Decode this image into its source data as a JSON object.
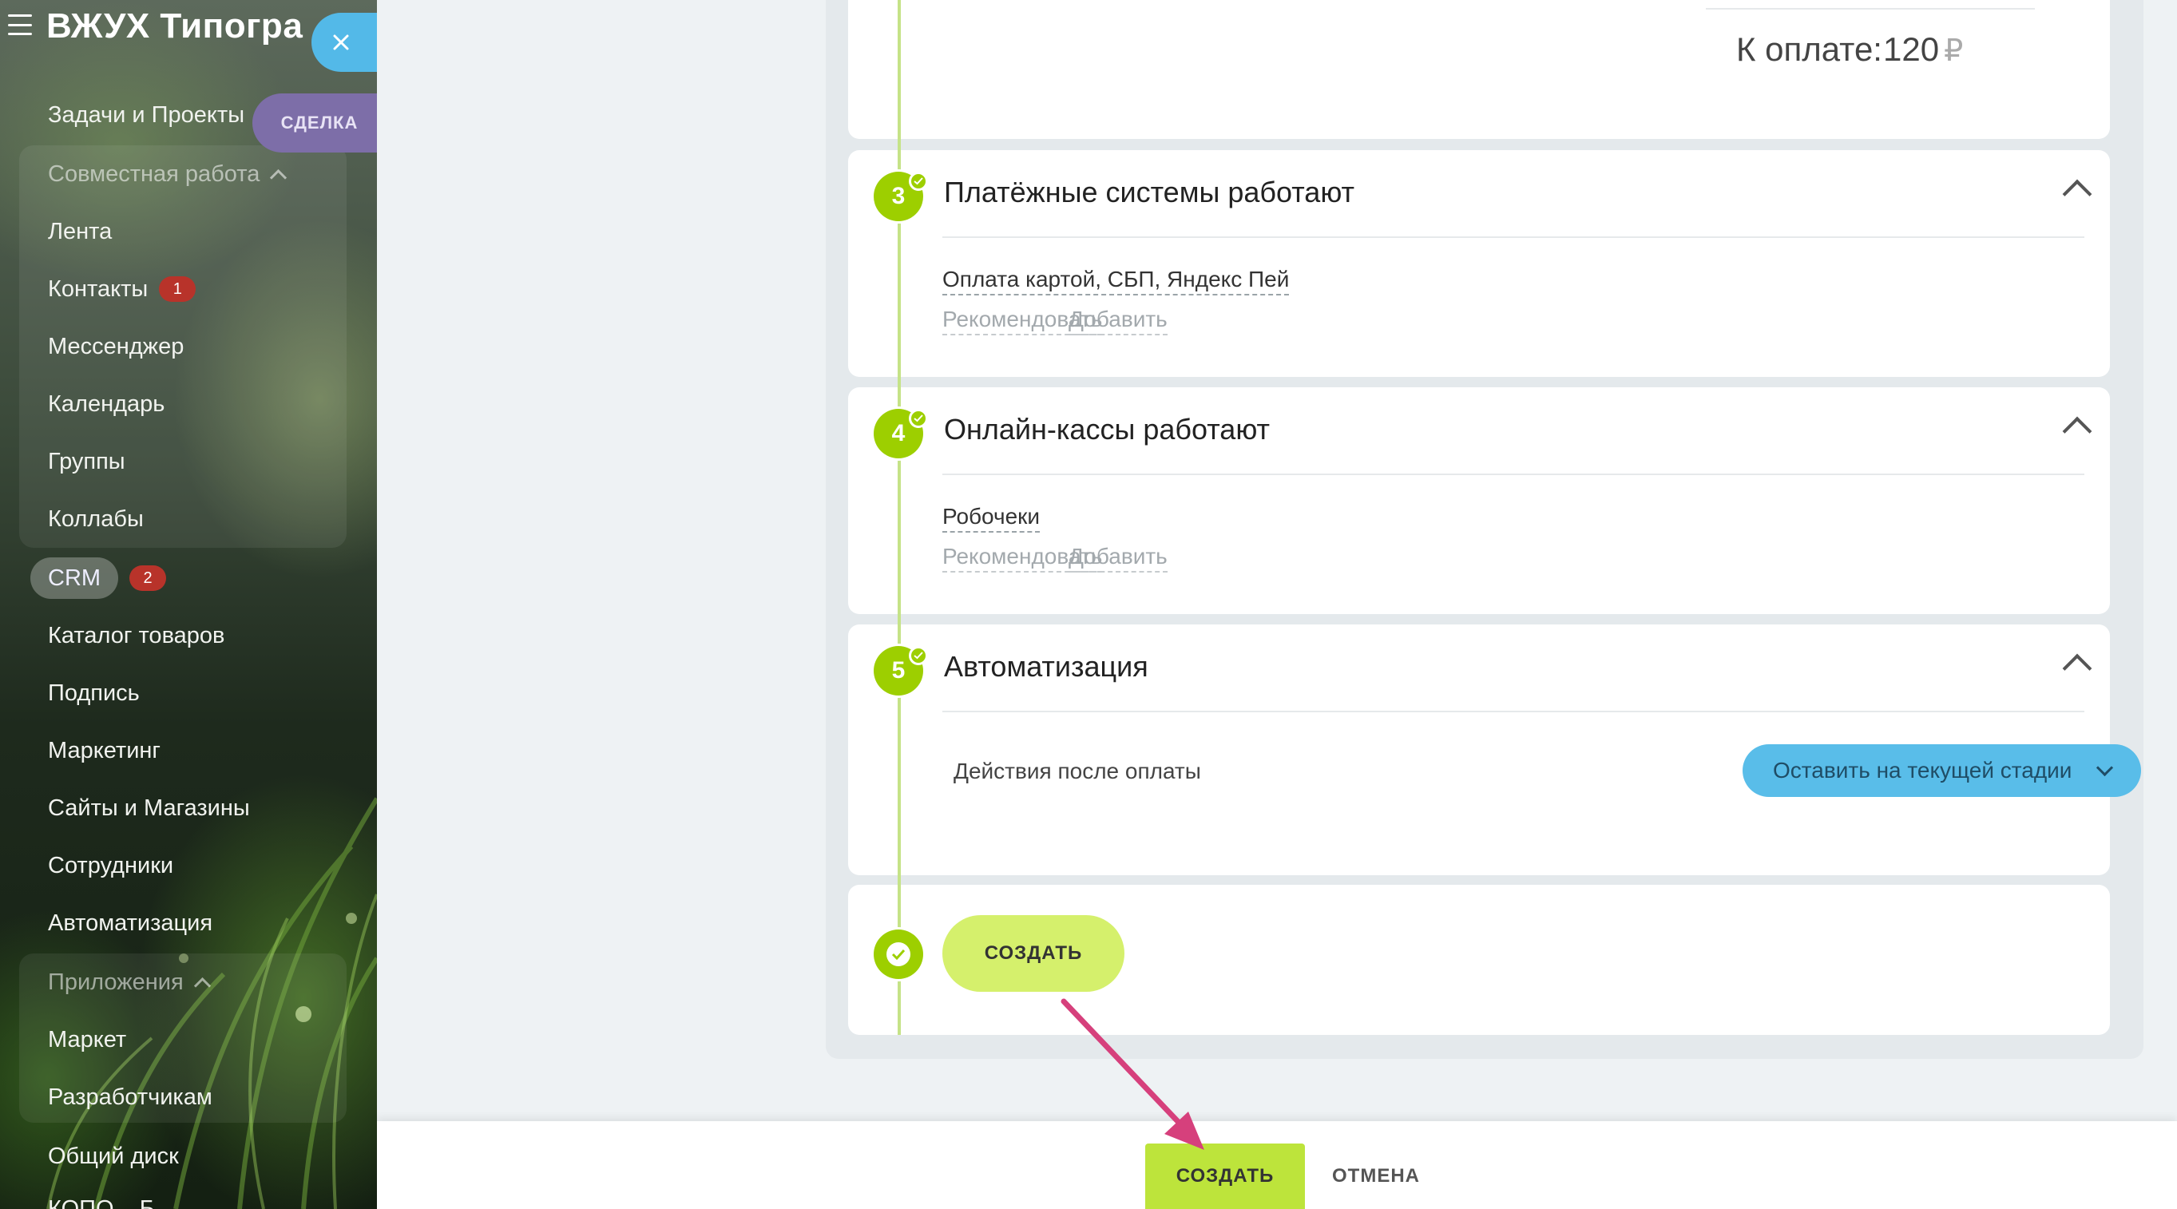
{
  "sidebar": {
    "title": "ВЖУХ Типогра",
    "deal_tab": "СДЕЛКА",
    "items": [
      {
        "label": "Задачи и Проекты"
      },
      {
        "label": "Совместная работа"
      },
      {
        "label": "Лента"
      },
      {
        "label": "Контакты",
        "badge": "1"
      },
      {
        "label": "Мессенджер"
      },
      {
        "label": "Календарь"
      },
      {
        "label": "Группы"
      },
      {
        "label": "Коллабы"
      },
      {
        "label": "CRM",
        "badge": "2"
      },
      {
        "label": "Каталог товаров"
      },
      {
        "label": "Подпись"
      },
      {
        "label": "Маркетинг"
      },
      {
        "label": "Сайты и Магазины"
      },
      {
        "label": "Сотрудники"
      },
      {
        "label": "Автоматизация"
      },
      {
        "label": "Приложения"
      },
      {
        "label": "Маркет"
      },
      {
        "label": "Разработчикам"
      },
      {
        "label": "Общий диск"
      },
      {
        "label": "КОПО... Б..."
      }
    ]
  },
  "summary": {
    "total_label": "К оплате:",
    "total_value": "120",
    "currency": "₽"
  },
  "steps": [
    {
      "number": "3",
      "title": "Платёжные системы работают",
      "value": "Оплата картой, СБП, Яндекс Пей",
      "recommend": "Рекомендовать",
      "add": "Добавить"
    },
    {
      "number": "4",
      "title": "Онлайн-кассы работают",
      "value": "Робочеки",
      "recommend": "Рекомендовать",
      "add": "Добавить"
    },
    {
      "number": "5",
      "title": "Автоматизация",
      "action_label": "Действия после оплаты",
      "select_value": "Оставить на текущей стадии"
    }
  ],
  "create_pill": "СОЗДАТЬ",
  "footer": {
    "create": "СОЗДАТЬ",
    "cancel": "ОТМЕНА"
  },
  "colors": {
    "accent_green": "#9dcf00",
    "create_button": "#bde43b",
    "select_blue": "#59bde9",
    "arrow": "#d6407c"
  }
}
